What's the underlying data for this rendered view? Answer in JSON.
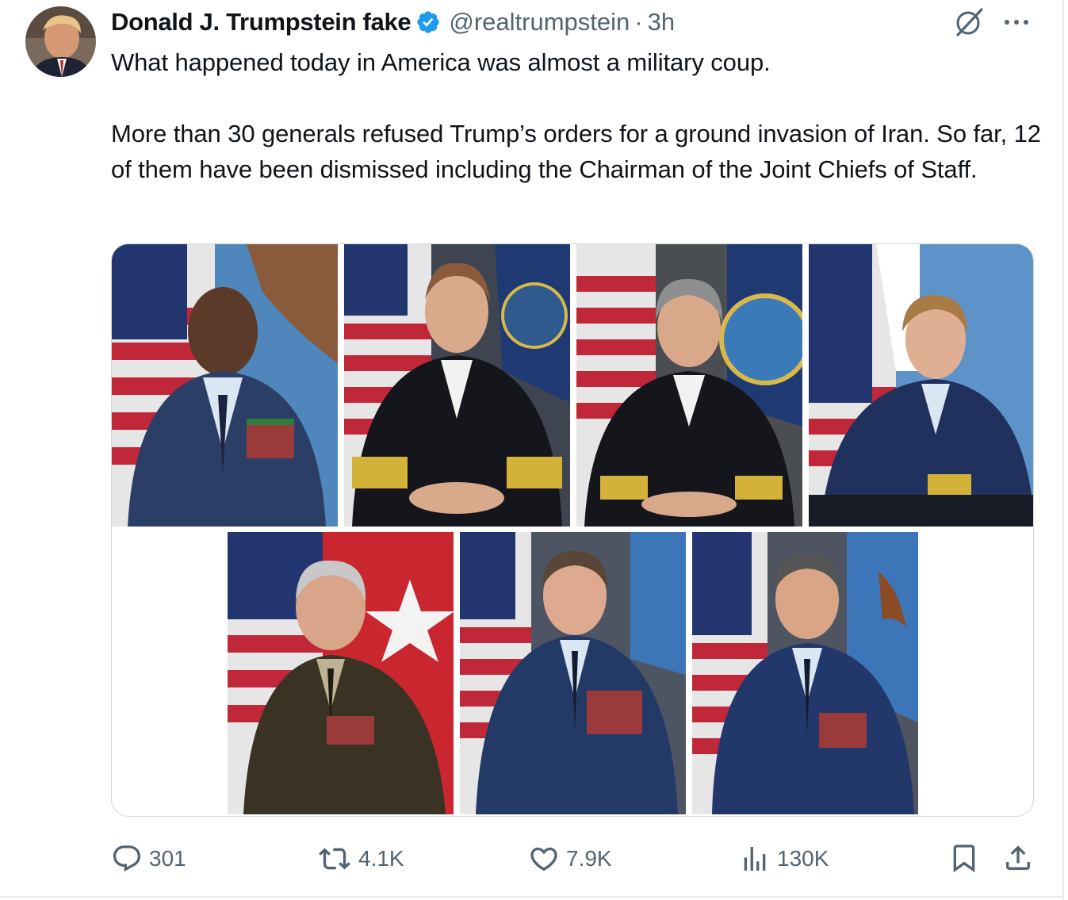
{
  "author": {
    "display_name": "Donald J. Trumpstein fake",
    "handle": "@realtrumpstein",
    "separator": "·",
    "time": "3h",
    "verified": true
  },
  "tweet": {
    "paragraphs": [
      "What happened today in America was almost a military coup.",
      "More than 30 generals refused Trump’s orders for a ground invasion of Iran. So far, 12 of them have been dismissed including the Chairman of the Joint Chiefs of Staff."
    ]
  },
  "media": {
    "photos": [
      {
        "name": "air-force-general-portrait",
        "uniform": "#2b3e66"
      },
      {
        "name": "navy-admiral-portrait",
        "uniform": "#14161c"
      },
      {
        "name": "navy-admiral-portrait-2",
        "uniform": "#14161c"
      },
      {
        "name": "coast-guard-admiral-portrait",
        "uniform": "#1f315c"
      },
      {
        "name": "army-general-portrait",
        "uniform": "#3a3324"
      },
      {
        "name": "air-force-general-portrait-2",
        "uniform": "#243a66"
      },
      {
        "name": "air-force-general-portrait-3",
        "uniform": "#22376a"
      }
    ]
  },
  "actions": {
    "replies": "301",
    "reposts": "4.1K",
    "likes": "7.9K",
    "views": "130K"
  },
  "icons": [
    "verified-badge-icon",
    "grok-icon",
    "more-icon",
    "reply-icon",
    "repost-icon",
    "like-icon",
    "views-icon",
    "bookmark-icon",
    "share-icon"
  ],
  "colors": {
    "text": "#0f1419",
    "secondary": "#536471",
    "verified": "#1d9bf0",
    "border": "#cfd9de"
  }
}
